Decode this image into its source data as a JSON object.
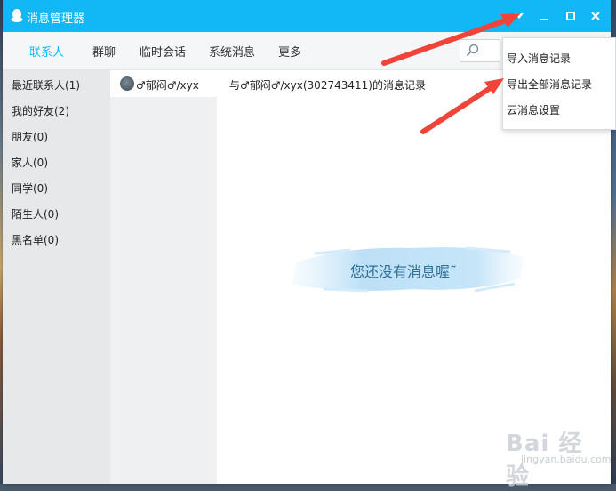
{
  "window": {
    "title": "消息管理器"
  },
  "tabs": [
    {
      "label": "联系人",
      "active": true
    },
    {
      "label": "群聊"
    },
    {
      "label": "临时会话"
    },
    {
      "label": "系统消息"
    },
    {
      "label": "更多"
    }
  ],
  "search": {
    "hint": "搜索"
  },
  "groups": [
    {
      "label": "最近联系人(1)"
    },
    {
      "label": "我的好友(2)"
    },
    {
      "label": "朋友(0)"
    },
    {
      "label": "家人(0)"
    },
    {
      "label": "同学(0)"
    },
    {
      "label": "陌生人(0)"
    },
    {
      "label": "黑名单(0)"
    }
  ],
  "contact": {
    "name": "♂郁闷♂/xyx"
  },
  "content": {
    "record_title": "与♂郁闷♂/xyx(302743411)的消息记录",
    "empty_text": "您还没有消息喔˜"
  },
  "menu": [
    {
      "label": "导入消息记录"
    },
    {
      "label": "导出全部消息记录"
    },
    {
      "label": "云消息设置"
    }
  ],
  "colors": {
    "accent": "#12b7f5",
    "arrow": "#f0443a"
  },
  "watermark": {
    "text": "Bai 经验",
    "sub": "jingyan.baidu.com"
  }
}
